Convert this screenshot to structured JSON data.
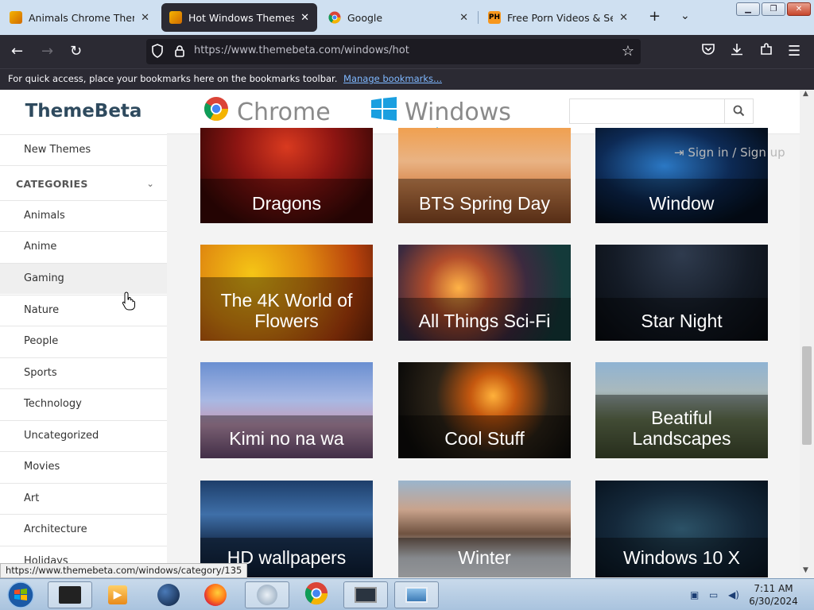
{
  "browser": {
    "tabs": [
      {
        "title": "Animals Chrome Themes -",
        "favicon": "themebeta-favicon"
      },
      {
        "title": "Hot Windows Themes all -",
        "favicon": "themebeta-favicon"
      },
      {
        "title": "Google",
        "favicon": "google-chrome-favicon"
      },
      {
        "title": "Free Porn Videos & Sex Mo",
        "favicon": "ph-favicon",
        "favicon_text": "PH"
      }
    ],
    "url": "https://www.themebeta.com/windows/hot",
    "bookmarks_hint": "For quick access, place your bookmarks here on the bookmarks toolbar.",
    "bookmarks_link": "Manage bookmarks..."
  },
  "sidebar": {
    "logo": "ThemeBeta",
    "new_themes": "New Themes",
    "categories_label": "CATEGORIES",
    "items": [
      "Animals",
      "Anime",
      "Gaming",
      "Nature",
      "People",
      "Sports",
      "Technology",
      "Uncategorized",
      "Movies",
      "Art",
      "Architecture",
      "Holidays"
    ]
  },
  "topnav": {
    "chrome_label": "Chrome",
    "windows_label": "Windows",
    "search_placeholder": ""
  },
  "auth": {
    "signin": "Sign in / Sign up"
  },
  "themes": [
    {
      "title": "Dragons"
    },
    {
      "title": "BTS Spring Day"
    },
    {
      "title": "Window"
    },
    {
      "title": "The 4K World of Flowers"
    },
    {
      "title": "All Things Sci-Fi"
    },
    {
      "title": "Star Night"
    },
    {
      "title": "Kimi no na wa"
    },
    {
      "title": "Cool Stuff"
    },
    {
      "title": "Beatiful Landscapes"
    },
    {
      "title": "HD wallpapers"
    },
    {
      "title": "Winter"
    },
    {
      "title": "Windows 10 X"
    }
  ],
  "status_url": "https://www.themebeta.com/windows/category/135",
  "taskbar": {
    "time": "7:11 AM",
    "date": "6/30/2024"
  },
  "colors": {
    "browser_dark": "#2b2a33",
    "accent": "#1a9fe0",
    "logo": "#2e4a5e"
  }
}
